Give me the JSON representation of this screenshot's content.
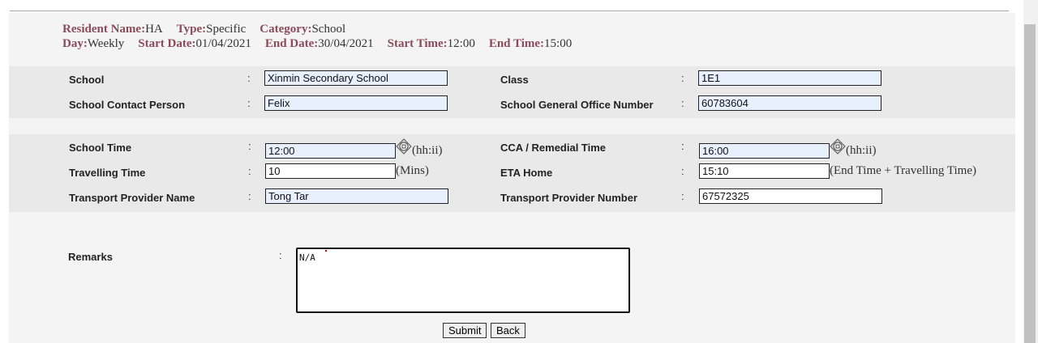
{
  "header": {
    "resident_name_label": "Resident Name:",
    "resident_name": "HA",
    "type_label": "Type:",
    "type": "Specific",
    "category_label": "Category:",
    "category": "School",
    "day_label": "Day:",
    "day": "Weekly",
    "start_date_label": "Start Date:",
    "start_date": "01/04/2021",
    "end_date_label": "End Date:",
    "end_date": "30/04/2021",
    "start_time_label": "Start Time:",
    "start_time": "12:00",
    "end_time_label": "End Time:",
    "end_time": "15:00"
  },
  "colon": ":",
  "school": {
    "school_label": "School",
    "school_value": "Xinmin Secondary School",
    "class_label": "Class",
    "class_value": "1E1",
    "contact_label": "School Contact Person",
    "contact_value": "Felix",
    "office_label": "School General Office Number",
    "office_value": "60783604"
  },
  "timing": {
    "school_time_label": "School Time",
    "school_time_value": "12:00",
    "time_format": "(hh:ii)",
    "cca_label": "CCA / Remedial Time",
    "cca_value": "16:00",
    "travel_label": "Travelling Time",
    "travel_value": "10",
    "travel_unit": "(Mins)",
    "eta_label": "ETA Home",
    "eta_value": "15:10",
    "eta_hint": "(End Time + Travelling Time)",
    "provider_name_label": "Transport Provider Name",
    "provider_name_value": "Tong Tar",
    "provider_number_label": "Transport Provider Number",
    "provider_number_value": "67572325"
  },
  "remarks": {
    "label": "Remarks",
    "value": "N/A"
  },
  "buttons": {
    "submit": "Submit",
    "back": "Back"
  },
  "colors": {
    "label_accent": "#8b4a5e",
    "input_fill": "#e8f0fe"
  },
  "icons": {
    "time_picker": "clock-icon"
  }
}
